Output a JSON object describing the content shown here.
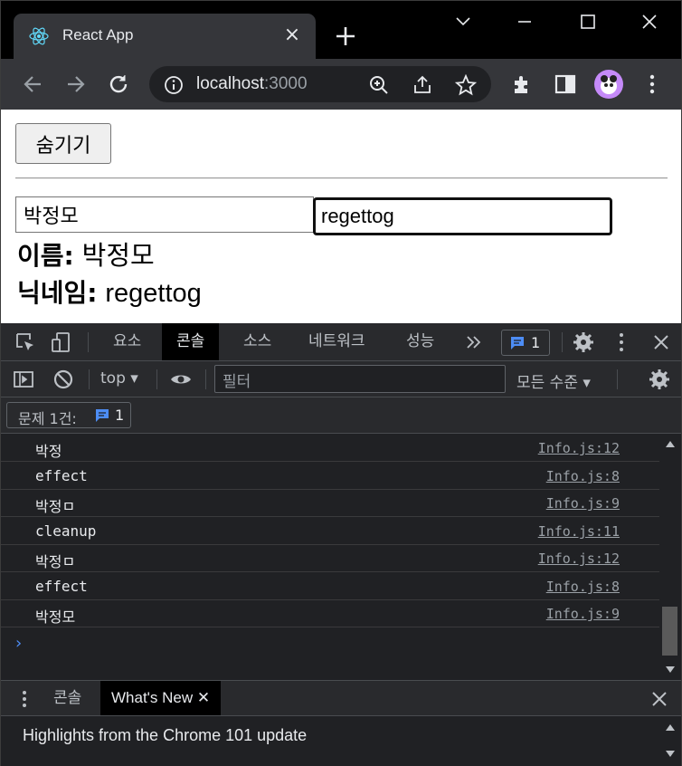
{
  "browser": {
    "tab_title": "React App",
    "url_host": "localhost",
    "url_port": ":3000"
  },
  "page": {
    "hide_button": "숨기기",
    "name_input_value": "박정모",
    "nickname_input_value": "regettog",
    "name_label": "이름",
    "name_value": "박정모",
    "nickname_label": "닉네임",
    "nickname_value": "regettog",
    "colon": ":"
  },
  "devtools": {
    "tabs": [
      "요소",
      "콘솔",
      "소스",
      "네트워크",
      "성능"
    ],
    "issues_count": "1",
    "context": "top",
    "filter_placeholder": "필터",
    "levels": "모든 수준",
    "issues_label": "문제 1건:",
    "issues_badge": "1",
    "logs": [
      {
        "msg": "박정",
        "src": "Info.js:12"
      },
      {
        "msg": "effect",
        "src": "Info.js:8"
      },
      {
        "msg": "박정ㅁ",
        "src": "Info.js:9"
      },
      {
        "msg": "cleanup",
        "src": "Info.js:11"
      },
      {
        "msg": "박정ㅁ",
        "src": "Info.js:12"
      },
      {
        "msg": "effect",
        "src": "Info.js:8"
      },
      {
        "msg": "박정모",
        "src": "Info.js:9"
      }
    ],
    "prompt": "›",
    "drawer": {
      "console_tab": "콘솔",
      "whats_new_tab": "What's New",
      "headline": "Highlights from the Chrome 101 update"
    }
  }
}
